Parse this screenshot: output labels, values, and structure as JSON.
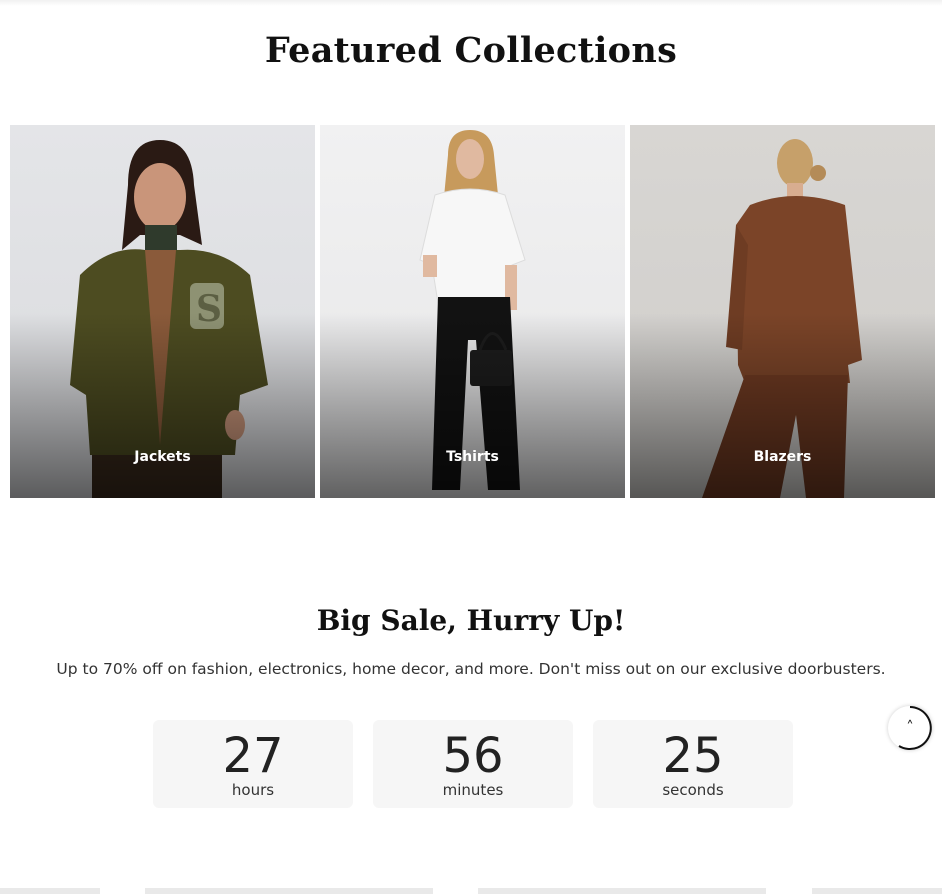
{
  "featured": {
    "title": "Featured Collections",
    "collections": [
      {
        "label": "Jackets"
      },
      {
        "label": "Tshirts"
      },
      {
        "label": "Blazers"
      }
    ]
  },
  "sale": {
    "title": "Big Sale, Hurry Up!",
    "description": "Up to 70% off on fashion, electronics, home decor, and more. Don't miss out on our exclusive doorbusters.",
    "countdown": [
      {
        "value": "27",
        "unit": "hours"
      },
      {
        "value": "56",
        "unit": "minutes"
      },
      {
        "value": "25",
        "unit": "seconds"
      }
    ]
  },
  "colors": {
    "jacket": "#4a4a1e",
    "tshirt": "#ffffff",
    "pants": "#111111",
    "blazer": "#7a4327"
  },
  "icons": {
    "scroll_top": "double-chevron-up-icon"
  }
}
